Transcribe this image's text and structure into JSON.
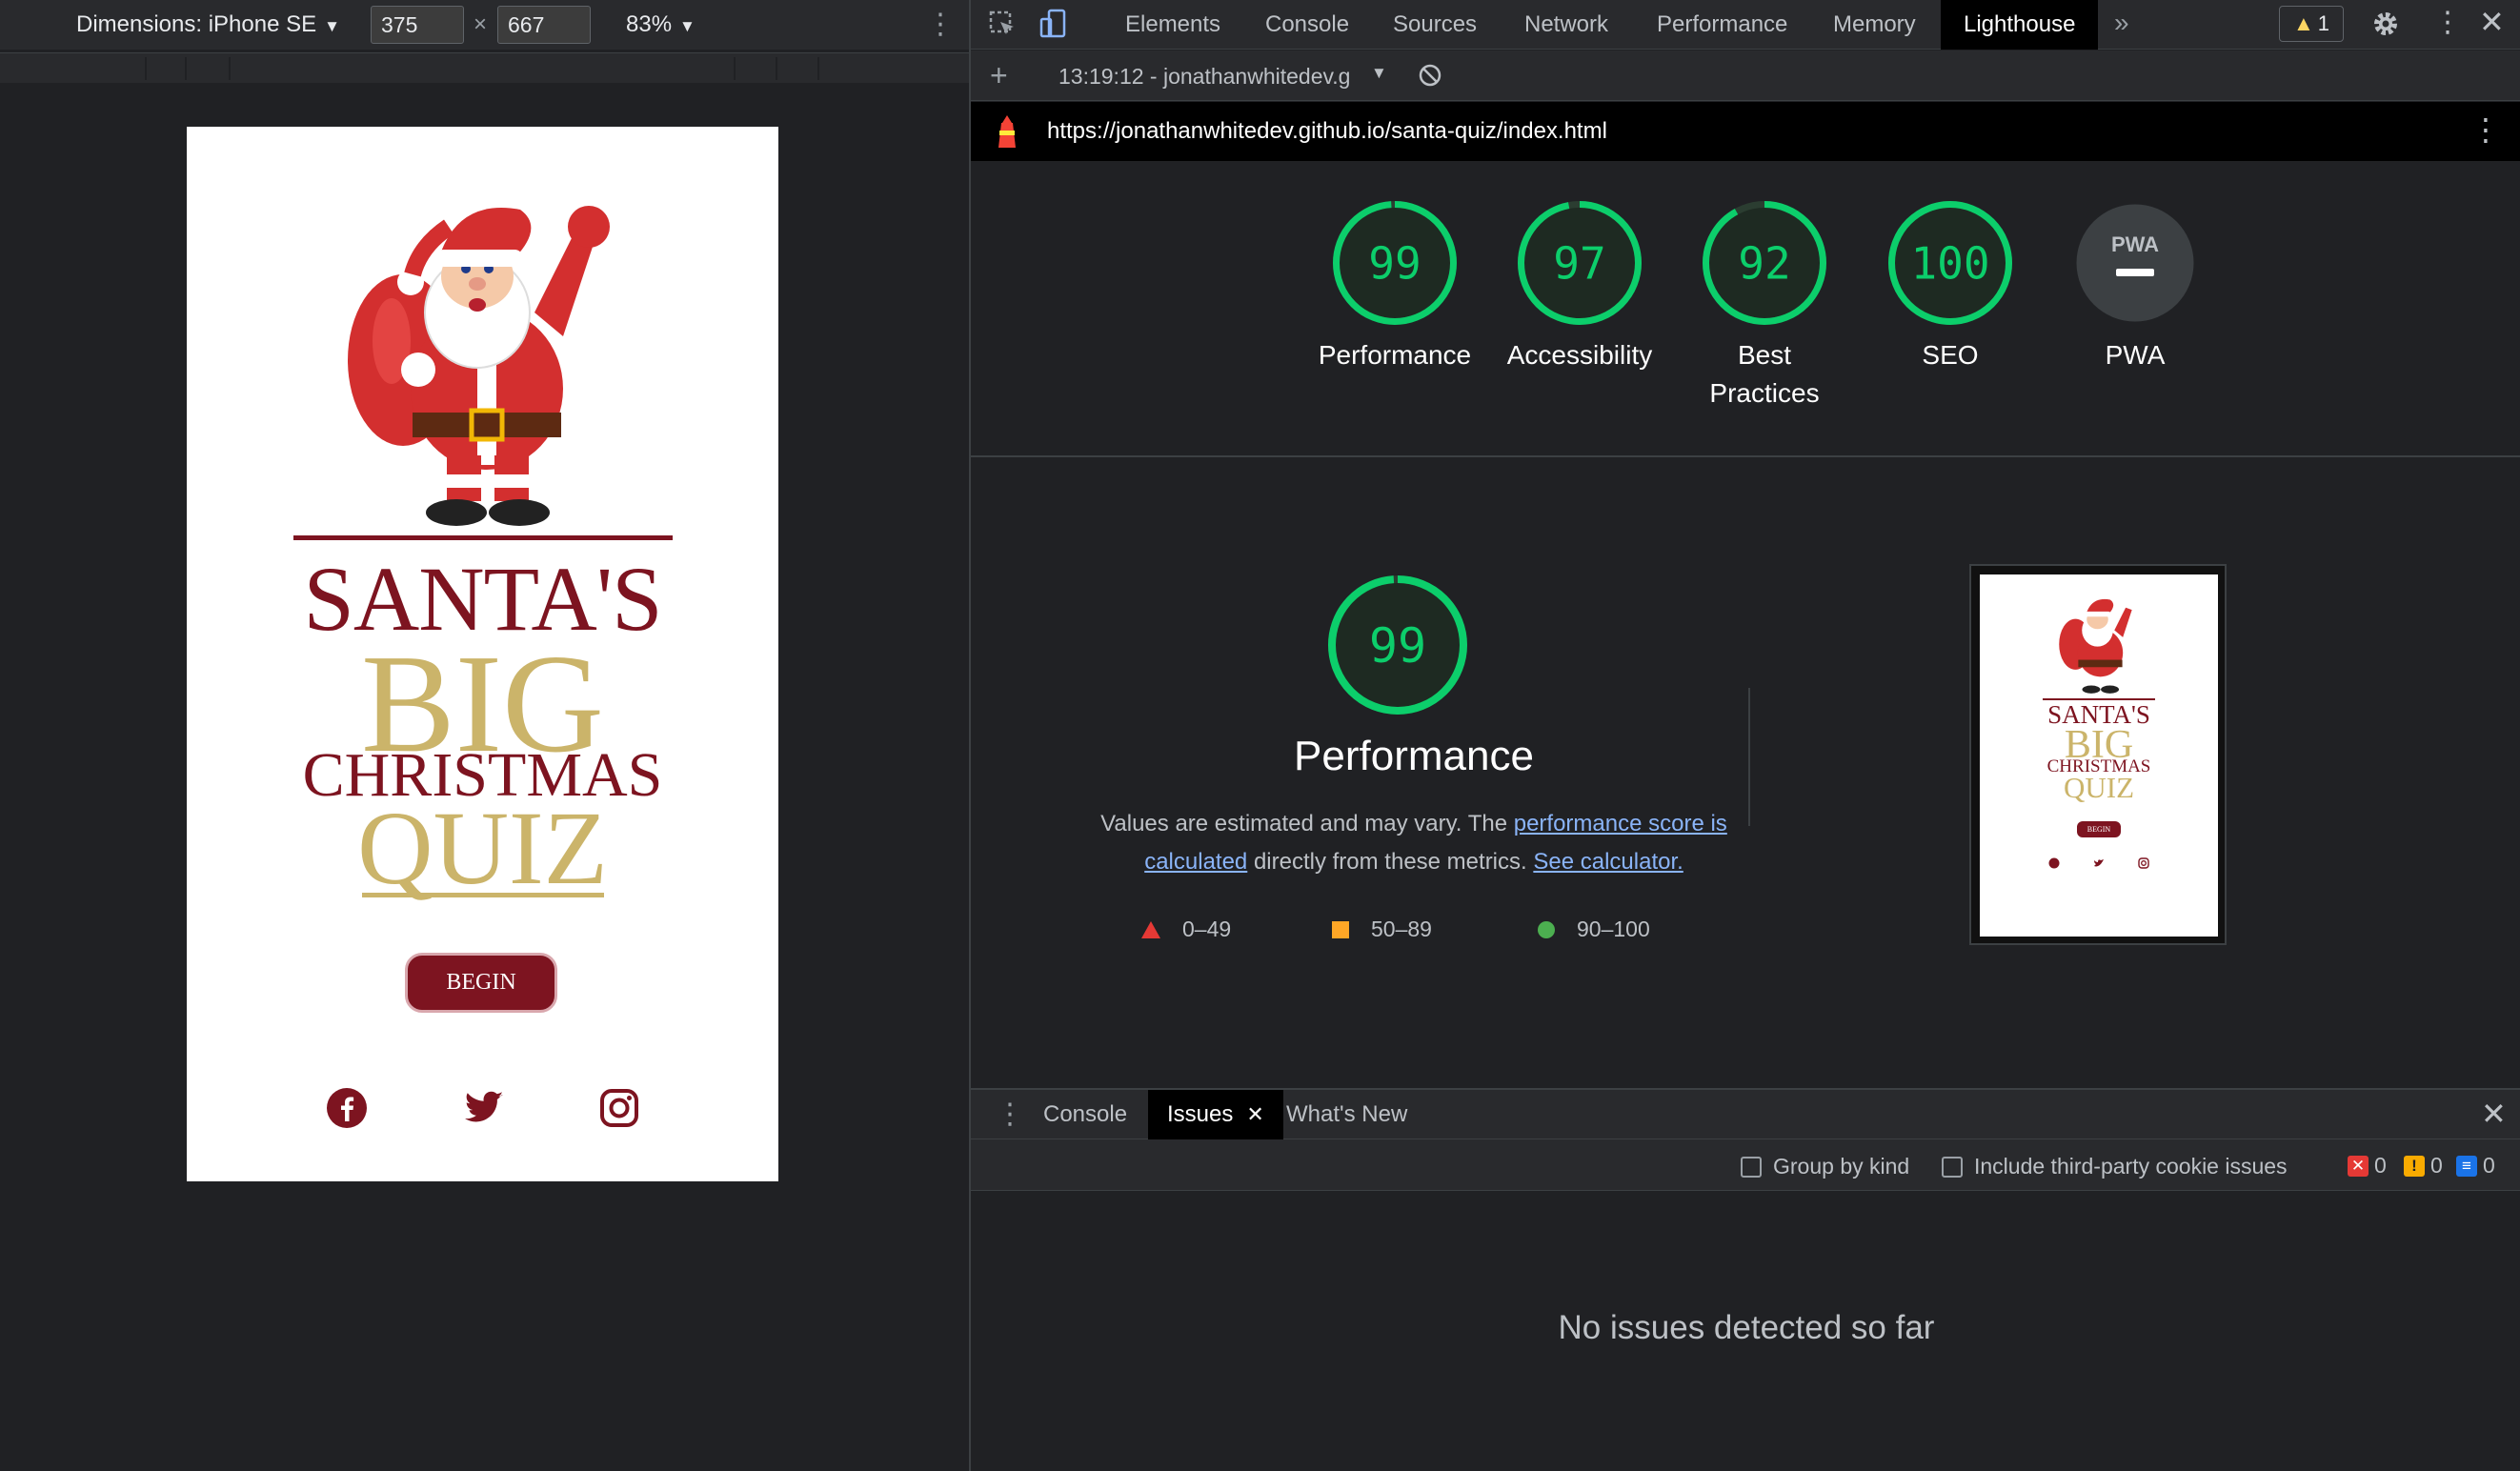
{
  "device_toolbar": {
    "dimensions_label": "Dimensions: iPhone SE",
    "width": "375",
    "height": "667",
    "times": "×",
    "zoom": "83%"
  },
  "emulated_page": {
    "title_line1": "SANTA'S",
    "title_line2": "BIG",
    "title_line3": "CHRISTMAS",
    "title_line4": "QUIZ",
    "begin_label": "BEGIN",
    "social_icons": [
      "facebook-icon",
      "twitter-icon",
      "instagram-icon"
    ]
  },
  "devtools": {
    "tabs": [
      "Elements",
      "Console",
      "Sources",
      "Network",
      "Performance",
      "Memory",
      "Lighthouse"
    ],
    "active_tab": "Lighthouse",
    "more_tabs": "»",
    "warning_count": "1"
  },
  "lighthouse": {
    "report_select": "13:19:12 - jonathanwhitedev.g",
    "url": "https://jonathanwhitedev.github.io/santa-quiz/index.html",
    "scores": [
      {
        "label": "Performance",
        "score": 99
      },
      {
        "label": "Accessibility",
        "score": 97
      },
      {
        "label": "Best Practices",
        "score": 92
      },
      {
        "label": "SEO",
        "score": 100
      },
      {
        "label": "PWA",
        "score": null
      }
    ],
    "pwa_badge": "PWA",
    "performance": {
      "score": "99",
      "title": "Performance",
      "desc_prefix": "Values are estimated and may vary. The ",
      "desc_link1": "performance score is calculated",
      "desc_middle": " directly from these metrics. ",
      "desc_link2": "See calculator."
    },
    "legend": [
      {
        "range": "0–49",
        "color": "#e53935",
        "shape": "triangle"
      },
      {
        "range": "50–89",
        "color": "#ffa726",
        "shape": "square"
      },
      {
        "range": "90–100",
        "color": "#4caf50",
        "shape": "circle"
      }
    ],
    "thumb": {
      "l1": "SANTA'S",
      "l2": "BIG",
      "l3": "CHRISTMAS",
      "l4": "QUIZ",
      "begin": "BEGIN"
    }
  },
  "drawer": {
    "tabs": [
      "Console",
      "Issues",
      "What's New"
    ],
    "active_tab": "Issues",
    "group_by_kind": "Group by kind",
    "third_party": "Include third-party cookie issues",
    "counts": {
      "errors": "0",
      "warnings": "0",
      "info": "0"
    },
    "empty_message": "No issues detected so far"
  },
  "colors": {
    "good": "#0cce6b",
    "accent_red": "#7d1420",
    "accent_gold": "#cbb46a"
  }
}
